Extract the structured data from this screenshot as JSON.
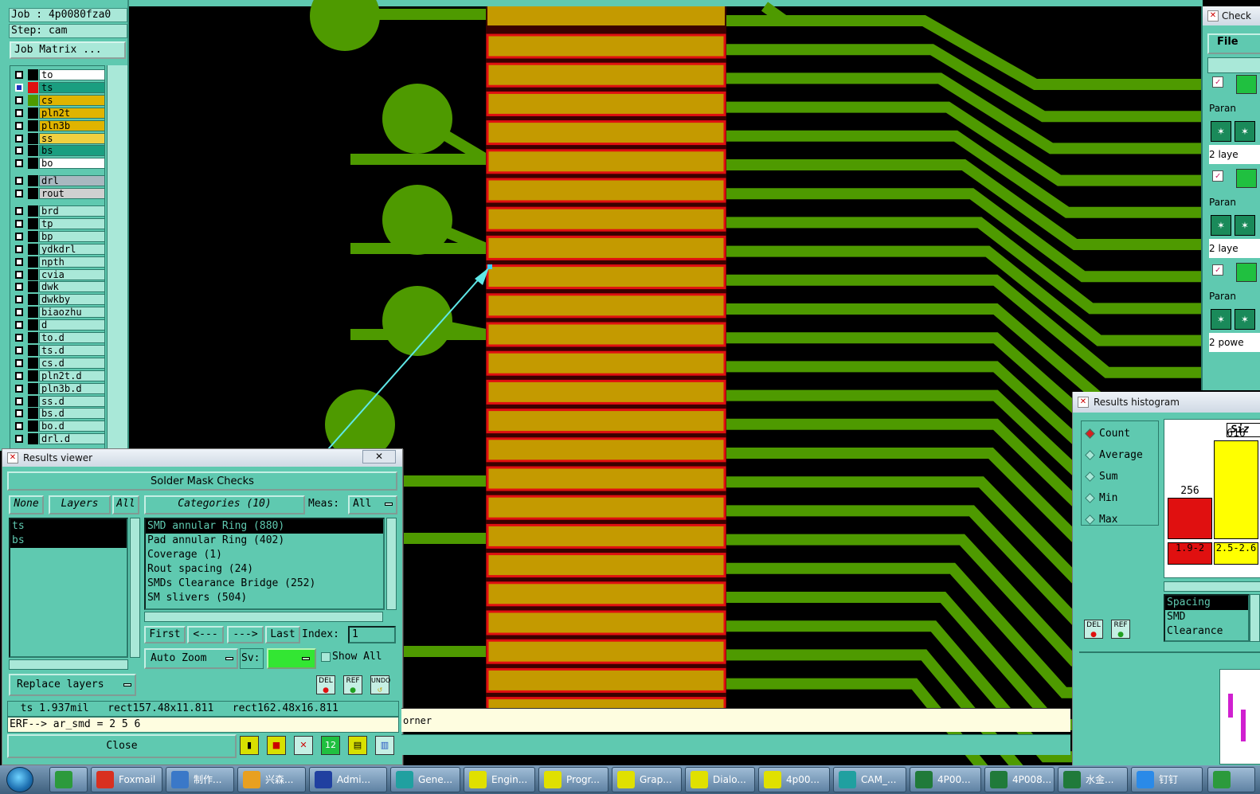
{
  "colors": {
    "background": "#000000",
    "copper": "#4e9a00",
    "pad_fill": "#c49a00",
    "pad_outline": "#e01010",
    "panel": "#5fc9b0",
    "measure_line": "#5fe8e8"
  },
  "job": {
    "job_label": "Job : 4p0080fza0",
    "step_label": "Step: cam",
    "matrix_button": "Job Matrix ..."
  },
  "layers": [
    {
      "name": "to",
      "bg": "#ffffff",
      "swatch": "#000000",
      "selected": false
    },
    {
      "name": "ts",
      "bg": "#1a9e80",
      "swatch": "#e01010",
      "selected": true
    },
    {
      "name": "cs",
      "bg": "#e0b400",
      "swatch": "#4e9a00",
      "selected": false
    },
    {
      "name": "pln2t",
      "bg": "#e0b400",
      "swatch": "#000000",
      "selected": false
    },
    {
      "name": "pln3b",
      "bg": "#e0b400",
      "swatch": "#000000",
      "selected": false
    },
    {
      "name": "ss",
      "bg": "#f0d040",
      "swatch": "#000000",
      "selected": false
    },
    {
      "name": "bs",
      "bg": "#1a9e80",
      "swatch": "#000000",
      "selected": false
    },
    {
      "name": "bo",
      "bg": "#ffffff",
      "swatch": "#000000",
      "selected": false
    },
    {
      "name": "drl",
      "bg": "#a8b8c0",
      "swatch": "#000000",
      "selected": false
    },
    {
      "name": "rout",
      "bg": "#d0d0d0",
      "swatch": "#000000",
      "selected": false
    },
    {
      "name": "brd",
      "bg": "#a9e8d8",
      "swatch": "#000000",
      "selected": false
    },
    {
      "name": "tp",
      "bg": "#a9e8d8",
      "swatch": "#000000",
      "selected": false
    },
    {
      "name": "bp",
      "bg": "#a9e8d8",
      "swatch": "#000000",
      "selected": false
    },
    {
      "name": "ydkdrl",
      "bg": "#a9e8d8",
      "swatch": "#000000",
      "selected": false
    },
    {
      "name": "npth",
      "bg": "#a9e8d8",
      "swatch": "#000000",
      "selected": false
    },
    {
      "name": "cvia",
      "bg": "#a9e8d8",
      "swatch": "#000000",
      "selected": false
    },
    {
      "name": "dwk",
      "bg": "#a9e8d8",
      "swatch": "#000000",
      "selected": false
    },
    {
      "name": "dwkby",
      "bg": "#a9e8d8",
      "swatch": "#000000",
      "selected": false
    },
    {
      "name": "biaozhu",
      "bg": "#a9e8d8",
      "swatch": "#000000",
      "selected": false
    },
    {
      "name": "d",
      "bg": "#a9e8d8",
      "swatch": "#000000",
      "selected": false
    },
    {
      "name": "to.d",
      "bg": "#a9e8d8",
      "swatch": "#000000",
      "selected": false
    },
    {
      "name": "ts.d",
      "bg": "#a9e8d8",
      "swatch": "#000000",
      "selected": false
    },
    {
      "name": "cs.d",
      "bg": "#a9e8d8",
      "swatch": "#000000",
      "selected": false
    },
    {
      "name": "pln2t.d",
      "bg": "#a9e8d8",
      "swatch": "#000000",
      "selected": false
    },
    {
      "name": "pln3b.d",
      "bg": "#a9e8d8",
      "swatch": "#000000",
      "selected": false
    },
    {
      "name": "ss.d",
      "bg": "#a9e8d8",
      "swatch": "#000000",
      "selected": false
    },
    {
      "name": "bs.d",
      "bg": "#a9e8d8",
      "swatch": "#000000",
      "selected": false
    },
    {
      "name": "bo.d",
      "bg": "#a9e8d8",
      "swatch": "#000000",
      "selected": false
    },
    {
      "name": "drl.d",
      "bg": "#a9e8d8",
      "swatch": "#000000",
      "selected": false
    }
  ],
  "results_viewer": {
    "title": "Results viewer",
    "close_x": "✕",
    "header": "Solder Mask Checks",
    "btn_none": "None",
    "btn_layers": "Layers",
    "btn_all": "All",
    "categories_label": "Categories (10)",
    "meas_label": "Meas:",
    "meas_value": "All",
    "layer_items": [
      "ts",
      "bs"
    ],
    "category_items": [
      "SMD annular Ring (880)",
      "Pad annular Ring (402)",
      "Coverage (1)",
      "Rout spacing (24)",
      "SMDs Clearance Bridge (252)",
      "SM slivers (504)"
    ],
    "nav_first": "First",
    "nav_prev": "<---",
    "nav_next": "--->",
    "nav_last": "Last",
    "index_label": "Index:",
    "index_value": "1",
    "auto_zoom": "Auto Zoom",
    "sv_label": "Sv:",
    "show_all": "Show All",
    "replace_layers": "Replace layers",
    "btn_del": "DEL",
    "btn_ref": "REF",
    "btn_undo": "UNDO",
    "measurement": "  ts 1.937mil   rect157.48x11.811   rect162.48x16.811",
    "erf": "ERF--> ar_smd = 2 5 6",
    "close_label": "Close"
  },
  "message_strip": "orner",
  "check_panel": {
    "title": "Check",
    "file_menu": "File",
    "rows": [
      "Paran",
      "2 laye",
      "Paran",
      "2 laye",
      "Paran",
      "2 powe"
    ]
  },
  "histogram": {
    "title": "Results histogram",
    "modes": [
      "Count",
      "Average",
      "Sum",
      "Min",
      "Max"
    ],
    "active_mode": "Count",
    "size_label": "Siz",
    "bars": [
      {
        "label": "1.9-2",
        "value": 256,
        "color": "#e01010"
      },
      {
        "label": "2.5-2.6",
        "value": 616,
        "color": "#ffff00"
      }
    ],
    "btn_del": "DEL",
    "btn_ref": "REF",
    "list_items": [
      "Spacing",
      "SMD",
      "Clearance"
    ]
  },
  "taskbar": [
    {
      "label": "",
      "icon_color": "#2c9a3c"
    },
    {
      "label": "Foxmail",
      "icon_color": "#d83020"
    },
    {
      "label": "制作...",
      "icon_color": "#3a78c8"
    },
    {
      "label": "兴森...",
      "icon_color": "#e8a020"
    },
    {
      "label": "Admi...",
      "icon_color": "#2040a0"
    },
    {
      "label": "Gene...",
      "icon_color": "#20a0a0"
    },
    {
      "label": "Engin...",
      "icon_color": "#e0e000"
    },
    {
      "label": "Progr...",
      "icon_color": "#e0e000"
    },
    {
      "label": "Grap...",
      "icon_color": "#e0e000"
    },
    {
      "label": "Dialo...",
      "icon_color": "#e0e000"
    },
    {
      "label": "4p00...",
      "icon_color": "#e0e000"
    },
    {
      "label": "CAM_...",
      "icon_color": "#20a0a0"
    },
    {
      "label": "4P00...",
      "icon_color": "#207a3a"
    },
    {
      "label": "4P008...",
      "icon_color": "#207a3a"
    },
    {
      "label": "水金...",
      "icon_color": "#207a3a"
    },
    {
      "label": "钉钉",
      "icon_color": "#2a8ae8"
    },
    {
      "label": "",
      "icon_color": "#2c9a3c"
    }
  ]
}
